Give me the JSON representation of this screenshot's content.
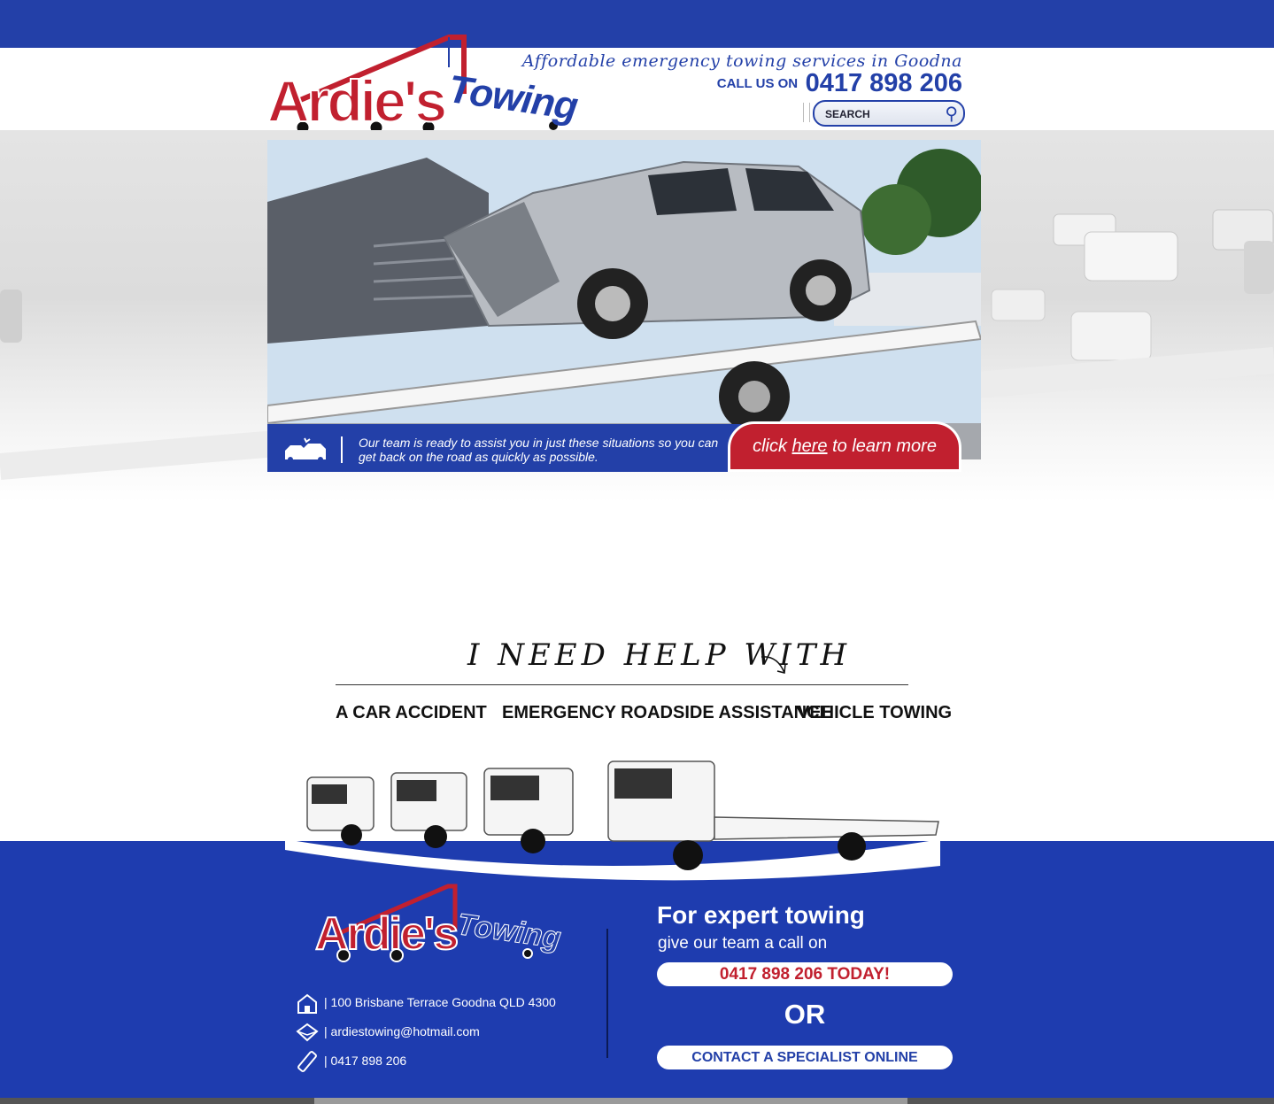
{
  "header": {
    "logo_text_main": "Ardie's",
    "logo_text_sub": "Towing",
    "tagline": "Affordable emergency towing services in Goodna",
    "call_label": "CALL US ON",
    "phone": "0417 898 206",
    "search_placeholder": "SEARCH"
  },
  "hero": {
    "banner_message": "Our team is ready to assist you in just these situations so you can get back on the road as quickly as possible.",
    "cta_prefix": "click ",
    "cta_link": "here",
    "cta_suffix": " to learn more"
  },
  "help": {
    "heading": "I NEED HELP WITH",
    "links": [
      "A CAR ACCIDENT",
      "EMERGENCY ROADSIDE ASSISTANCE",
      "VEHICLE TOWING"
    ]
  },
  "footer": {
    "logo_text_main": "Ardie's",
    "logo_text_sub": "Towing",
    "address": "| 100 Brisbane Terrace Goodna QLD 4300",
    "email": "| ardiestowing@hotmail.com",
    "phone": "| 0417 898 206",
    "expert_heading": "For expert towing",
    "callon_text": "give our team a call on",
    "phone_button": "0417 898 206 TODAY!",
    "or_text": "OR",
    "contact_button": "CONTACT A SPECIALIST ONLINE"
  },
  "colors": {
    "brand_blue": "#2340a8",
    "brand_red": "#c1202f",
    "footer_blue": "#1e3caf"
  },
  "icons": [
    "search-icon",
    "car-crash-icon",
    "house-icon",
    "envelope-icon",
    "phone-icon",
    "curved-arrow-icon"
  ]
}
